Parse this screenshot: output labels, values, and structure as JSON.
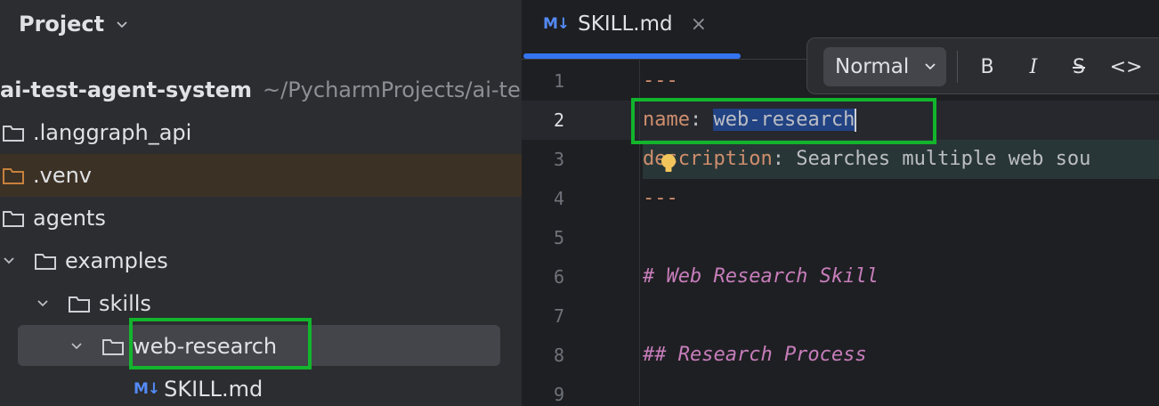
{
  "project_panel": {
    "title": "Project",
    "tree": [
      {
        "label": "ai-test-agent-system",
        "path": "~/PycharmProjects/ai-tes"
      },
      {
        "label": ".langgraph_api"
      },
      {
        "label": ".venv"
      },
      {
        "label": "agents"
      },
      {
        "label": "examples"
      },
      {
        "label": "skills"
      },
      {
        "label": "web-research"
      },
      {
        "label": "SKILL.md",
        "icon_text": "M↓"
      }
    ]
  },
  "editor": {
    "tab": {
      "icon_text": "M↓",
      "label": "SKILL.md",
      "close": "×"
    },
    "toolbar": {
      "style_value": "Normal",
      "bold": "B",
      "italic": "I",
      "strike": "S",
      "code": "<>"
    },
    "line_numbers": [
      "1",
      "2",
      "3",
      "4",
      "5",
      "6",
      "7",
      "8",
      "9"
    ],
    "lines": {
      "l1": "---",
      "l2_key": "name",
      "l2_colon": ": ",
      "l2_value": "web-research",
      "l3_key_a": "de",
      "l3_key_b": "scription",
      "l3_colon": ": ",
      "l3_value": "Searches multiple web sou",
      "l4": "---",
      "l6": "# Web Research Skill",
      "l8": "## Research Process"
    }
  },
  "colors": {
    "annotation": "#12b52c",
    "accent": "#3574f0",
    "selection": "#214283"
  }
}
